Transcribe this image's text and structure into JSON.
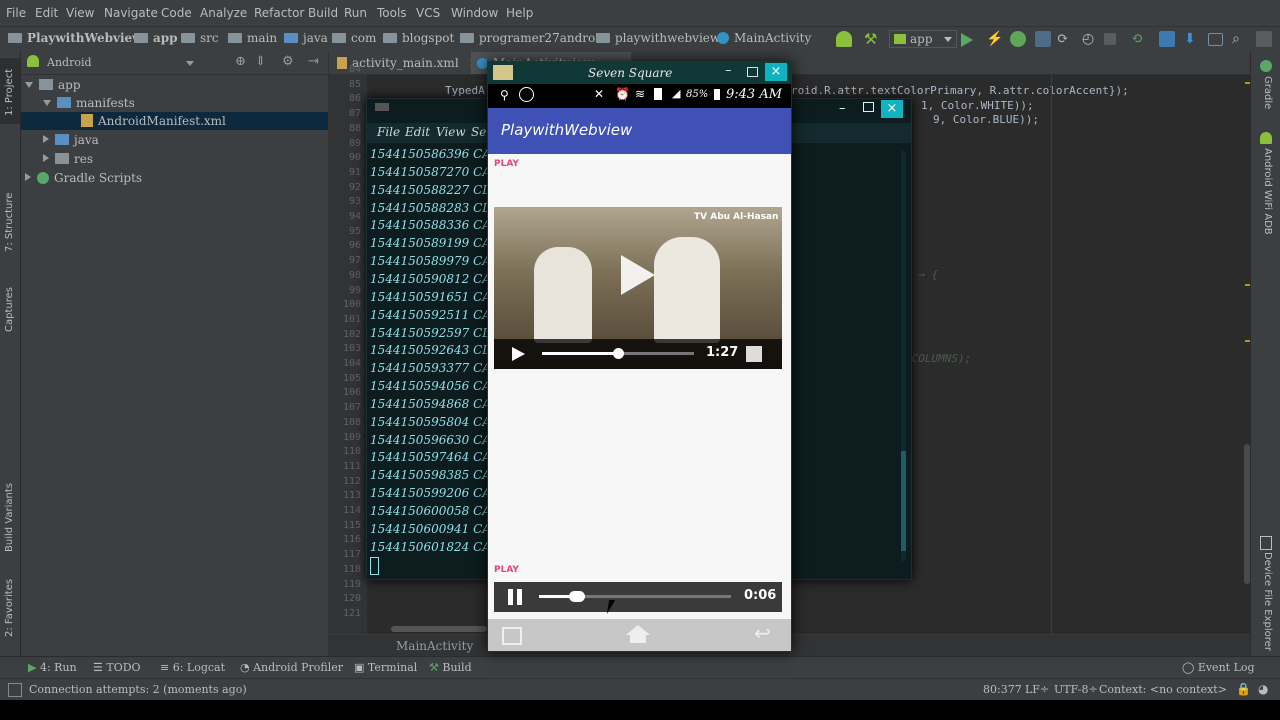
{
  "menu": [
    "File",
    "Edit",
    "View",
    "Navigate",
    "Code",
    "Analyze",
    "Refactor",
    "Build",
    "Run",
    "Tools",
    "VCS",
    "Window",
    "Help"
  ],
  "breadcrumbs": [
    "PlaywithWebview",
    "app",
    "src",
    "main",
    "java",
    "com",
    "blogspot",
    "programer27android",
    "playwithwebview",
    "MainActivity"
  ],
  "run_config": "app",
  "left_strip": [
    "1: Project",
    "7: Structure",
    "Captures",
    "Build Variants",
    "2: Favorites"
  ],
  "project": {
    "view_selector": "Android",
    "tree": [
      {
        "label": "app",
        "indent": 0,
        "expanded": true
      },
      {
        "label": "manifests",
        "indent": 1,
        "expanded": true
      },
      {
        "label": "AndroidManifest.xml",
        "indent": 2,
        "selected": true
      },
      {
        "label": "java",
        "indent": 1,
        "expanded": false
      },
      {
        "label": "res",
        "indent": 1,
        "expanded": false
      },
      {
        "label": "Gradle Scripts",
        "indent": 0,
        "expanded": false
      }
    ]
  },
  "editor": {
    "tabs": [
      "activity_main.xml",
      "MainActivity.java"
    ],
    "line_numbers": [
      "84",
      "85",
      "86",
      "87",
      "88",
      "89",
      "90",
      "91",
      "92",
      "93",
      "94",
      "95",
      "96",
      "97",
      "98",
      "99",
      "100",
      "101",
      "102",
      "103",
      "104",
      "105",
      "106",
      "107",
      "108",
      "109",
      "110",
      "111",
      "112",
      "113",
      "114",
      "115",
      "116",
      "117",
      "118",
      "119",
      "120",
      "121"
    ],
    "code_top": "TypedA",
    "code_right_1": "roid.R.attr.textColorPrimary, R.attr.colorAccent});",
    "code_right_2": "1, Color.WHITE));",
    "code_right_3": "9, Color.BLUE));",
    "breadcrumb_bottom": "MainActivity"
  },
  "right_strip": [
    "Gradle",
    "Android WiFi ADB",
    "Device File Explorer"
  ],
  "terminal": {
    "menu": [
      "File",
      "Edit",
      "View",
      "Se"
    ],
    "lines": [
      "1544150586396  CAP",
      "1544150587270  CAP",
      "1544150588227  CLI C",
      "1544150588283  CLI C",
      "1544150588336  CAP",
      "1544150589199  CAP",
      "1544150589979  CAP",
      "1544150590812  CAP",
      "1544150591651  CAP",
      "1544150592511  CAP",
      "1544150592597  CLI C",
      "1544150592643  CLI C",
      "1544150593377  CAP",
      "1544150594056  CAP",
      "1544150594868  CAP",
      "1544150595804  CAP",
      "1544150596630  CAP",
      "1544150597464  CAP",
      "1544150598385  CAP",
      "1544150599206  CAP",
      "1544150600058  CAP",
      "1544150600941  CAP",
      "1544150601824  CAP"
    ]
  },
  "emulator": {
    "title": "Seven Square",
    "status_battery": "85%",
    "status_time": "9:43 AM",
    "app_title": "PlaywithWebview",
    "play_label_1": "PLAY",
    "video_watermark": "TV Abu Al-Hasan",
    "video_time": "1:27",
    "video_progress": 0.5,
    "play_label_2": "PLAY",
    "audio_time": "0:06",
    "audio_progress": 0.2
  },
  "bottom_tools": [
    "4: Run",
    "TODO",
    "6: Logcat",
    "Android Profiler",
    "Terminal",
    "Build",
    "Event Log"
  ],
  "status": {
    "message": "Connection attempts: 2 (moments ago)",
    "position": "80:377",
    "line_sep": "LF÷",
    "encoding": "UTF-8÷",
    "context": "Context: <no context>"
  },
  "colors": {
    "appbar": "#3f51b5",
    "play_label": "#e0457b",
    "ide_bg": "#2b2b2b",
    "terminal_text": "#8fe0e8"
  }
}
